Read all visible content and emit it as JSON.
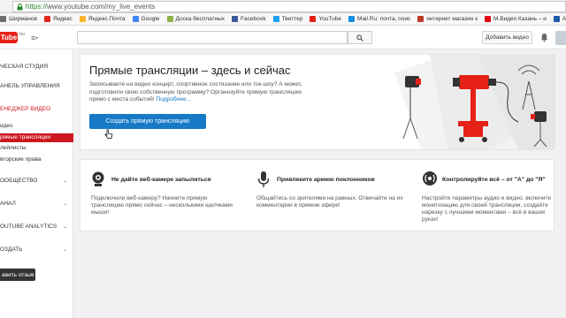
{
  "browser": {
    "url_protocol": "https://",
    "url_rest": "www.youtube.com/my_live_events",
    "bookmarks": [
      {
        "label": "Ширманов",
        "icon": "bookmark-icon",
        "color": "#6d6d6d"
      },
      {
        "label": "Яндекс",
        "icon": "yandex-icon",
        "color": "#e52620"
      },
      {
        "label": "Яндекс.Почта",
        "icon": "mail-icon",
        "color": "#fbb62e"
      },
      {
        "label": "Google",
        "icon": "google-icon",
        "color": "#4285f4"
      },
      {
        "label": "Доска бесплатных",
        "icon": "board-icon",
        "color": "#8fb34a"
      },
      {
        "label": "Facebook",
        "icon": "facebook-icon",
        "color": "#3b5998"
      },
      {
        "label": "Твиттер",
        "icon": "twitter-icon",
        "color": "#1da1f2"
      },
      {
        "label": "YouTube",
        "icon": "youtube-icon",
        "color": "#e62117"
      },
      {
        "label": "Mail.Ru: почта, поис",
        "icon": "mailru-icon",
        "color": "#168de2"
      },
      {
        "label": "интернет магазин к",
        "icon": "shop-icon",
        "color": "#c0392b"
      },
      {
        "label": "М.Видео Казань – и",
        "icon": "mvideo-icon",
        "color": "#e30613"
      },
      {
        "label": "ASUS",
        "icon": "asus-icon",
        "color": "#1e5aa8"
      }
    ]
  },
  "header": {
    "logo_text": "Tube",
    "logo_sup": "RU",
    "upload_label": "Добавить видео"
  },
  "sidebar": {
    "items": [
      {
        "label": "ЧЕСКАЯ СТУДИЯ",
        "type": "section"
      },
      {
        "label": "АНЕЛЬ УПРАВЛЕНИЯ",
        "type": "section"
      },
      {
        "label": "ЕНЕДЖЕР ВИДЕО",
        "type": "red"
      },
      {
        "label": "идео",
        "type": "sub"
      },
      {
        "label": "рямые трансляции",
        "type": "active"
      },
      {
        "label": "лейлисты",
        "type": "sub"
      },
      {
        "label": "вторские права",
        "type": "sub"
      },
      {
        "label": "ООБЩЕСТВО",
        "type": "section-chev"
      },
      {
        "label": "АНАЛ",
        "type": "section-chev"
      },
      {
        "label": "OUTUBE ANALYTICS",
        "type": "section-chev"
      },
      {
        "label": "ОЗДАТЬ",
        "type": "section-chev"
      }
    ],
    "feedback_label": "авить отзыв"
  },
  "hero": {
    "title": "Прямые трансляции – здесь и сейчас",
    "description": "Записываете на видео концерт, спортивное состязание или ток-шоу? А может, подготовили свою собственную программу? Организуйте прямую трансляцию прямо с места событий!",
    "link": "Подробнее...",
    "create_button": "Создать прямую трансляцию"
  },
  "features": [
    {
      "title": "Не дайте веб-камере запылиться",
      "text": "Подключили веб-камеру? Начните прямую трансляцию прямо сейчас – несколькими щелчками мыши!",
      "icon": "webcam-icon"
    },
    {
      "title": "Привлеките армию поклонников",
      "text": "Общайтесь со зрителями на равных. Отвечайте на их комментарии в прямом эфире!",
      "icon": "microphone-icon"
    },
    {
      "title": "Контролируйте всё – от \"А\" до \"Я\"",
      "text": "Настройте параметры аудио и видео, включите монетизацию для своей трансляции, создайте нарезку с лучшими моментами – всё в ваших руках!",
      "icon": "broadcast-control-icon"
    }
  ],
  "colors": {
    "brand_red": "#e62117",
    "accent_blue": "#167ac6",
    "active_red": "#cc181e"
  }
}
